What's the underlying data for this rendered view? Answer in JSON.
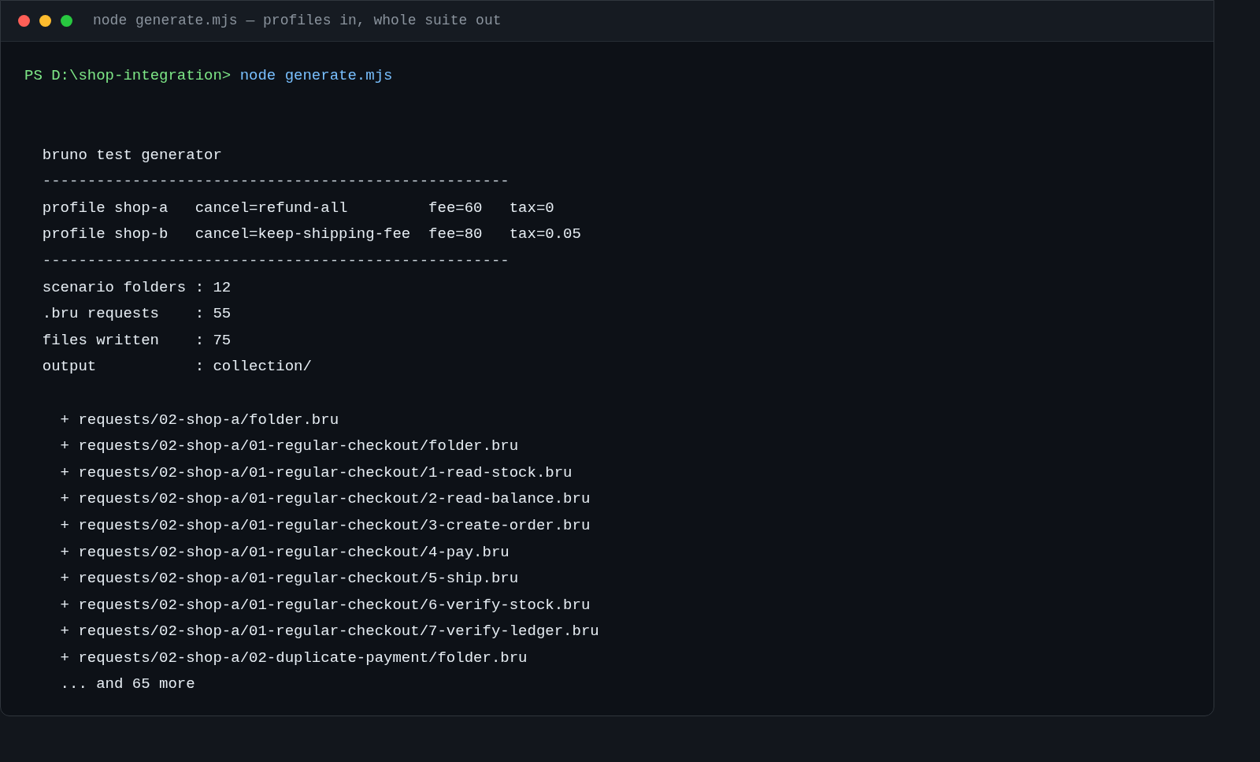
{
  "window": {
    "title": "node generate.mjs — profiles in, whole suite out"
  },
  "prompt": {
    "path": "PS D:\\shop-integration>",
    "command": "node generate.mjs"
  },
  "blocks": [
    {
      "lines": [
        {
          "kind": "heading",
          "text": "bruno test generator"
        },
        {
          "kind": "rule",
          "text": "----------------------------------------------------"
        },
        {
          "kind": "text",
          "text": "profile shop-a   cancel=refund-all         fee=60   tax=0"
        },
        {
          "kind": "text",
          "text": "profile shop-b   cancel=keep-shipping-fee  fee=80   tax=0.05"
        },
        {
          "kind": "rule",
          "text": "----------------------------------------------------"
        },
        {
          "kind": "text",
          "text": "scenario folders : 12"
        },
        {
          "kind": "text",
          "text": ".bru requests    : 55"
        },
        {
          "kind": "text",
          "text": "files written    : 75"
        },
        {
          "kind": "text",
          "text": "output           : collection/"
        }
      ]
    },
    {
      "lines": [
        {
          "kind": "file",
          "text": "+ requests/02-shop-a/folder.bru"
        },
        {
          "kind": "file",
          "text": "+ requests/02-shop-a/01-regular-checkout/folder.bru"
        },
        {
          "kind": "file",
          "text": "+ requests/02-shop-a/01-regular-checkout/1-read-stock.bru"
        },
        {
          "kind": "file",
          "text": "+ requests/02-shop-a/01-regular-checkout/2-read-balance.bru"
        },
        {
          "kind": "file",
          "text": "+ requests/02-shop-a/01-regular-checkout/3-create-order.bru"
        },
        {
          "kind": "file",
          "text": "+ requests/02-shop-a/01-regular-checkout/4-pay.bru"
        },
        {
          "kind": "file",
          "text": "+ requests/02-shop-a/01-regular-checkout/5-ship.bru"
        },
        {
          "kind": "file",
          "text": "+ requests/02-shop-a/01-regular-checkout/6-verify-stock.bru"
        },
        {
          "kind": "file",
          "text": "+ requests/02-shop-a/01-regular-checkout/7-verify-ledger.bru"
        },
        {
          "kind": "file",
          "text": "+ requests/02-shop-a/02-duplicate-payment/folder.bru"
        },
        {
          "kind": "more",
          "text": "... and 65 more"
        }
      ]
    }
  ]
}
